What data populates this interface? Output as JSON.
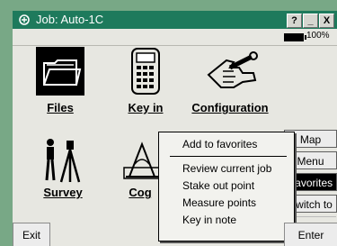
{
  "window": {
    "title": "Job: Auto-1C",
    "help_label": "?",
    "minimize_label": "_",
    "close_label": "X",
    "battery_text": "100%"
  },
  "apps": [
    {
      "label": "Files",
      "icon": "folder-icon"
    },
    {
      "label": "Key in",
      "icon": "keypad-icon"
    },
    {
      "label": "Configuration",
      "icon": "wrench-hand-icon"
    },
    {
      "label": "Survey",
      "icon": "tripod-icon"
    },
    {
      "label": "Cog",
      "icon": "cogo-icon"
    }
  ],
  "side_buttons": [
    {
      "label": "Map"
    },
    {
      "label": "Menu"
    },
    {
      "label": "Favorites"
    },
    {
      "label": "Switch to"
    }
  ],
  "context_menu": {
    "items": [
      {
        "label": "Add to favorites"
      },
      {
        "label": "Review current job"
      },
      {
        "label": "Stake out point"
      },
      {
        "label": "Measure points"
      },
      {
        "label": "Key in note"
      }
    ]
  },
  "bottom": {
    "exit_label": "Exit",
    "enter_label": "Enter"
  }
}
